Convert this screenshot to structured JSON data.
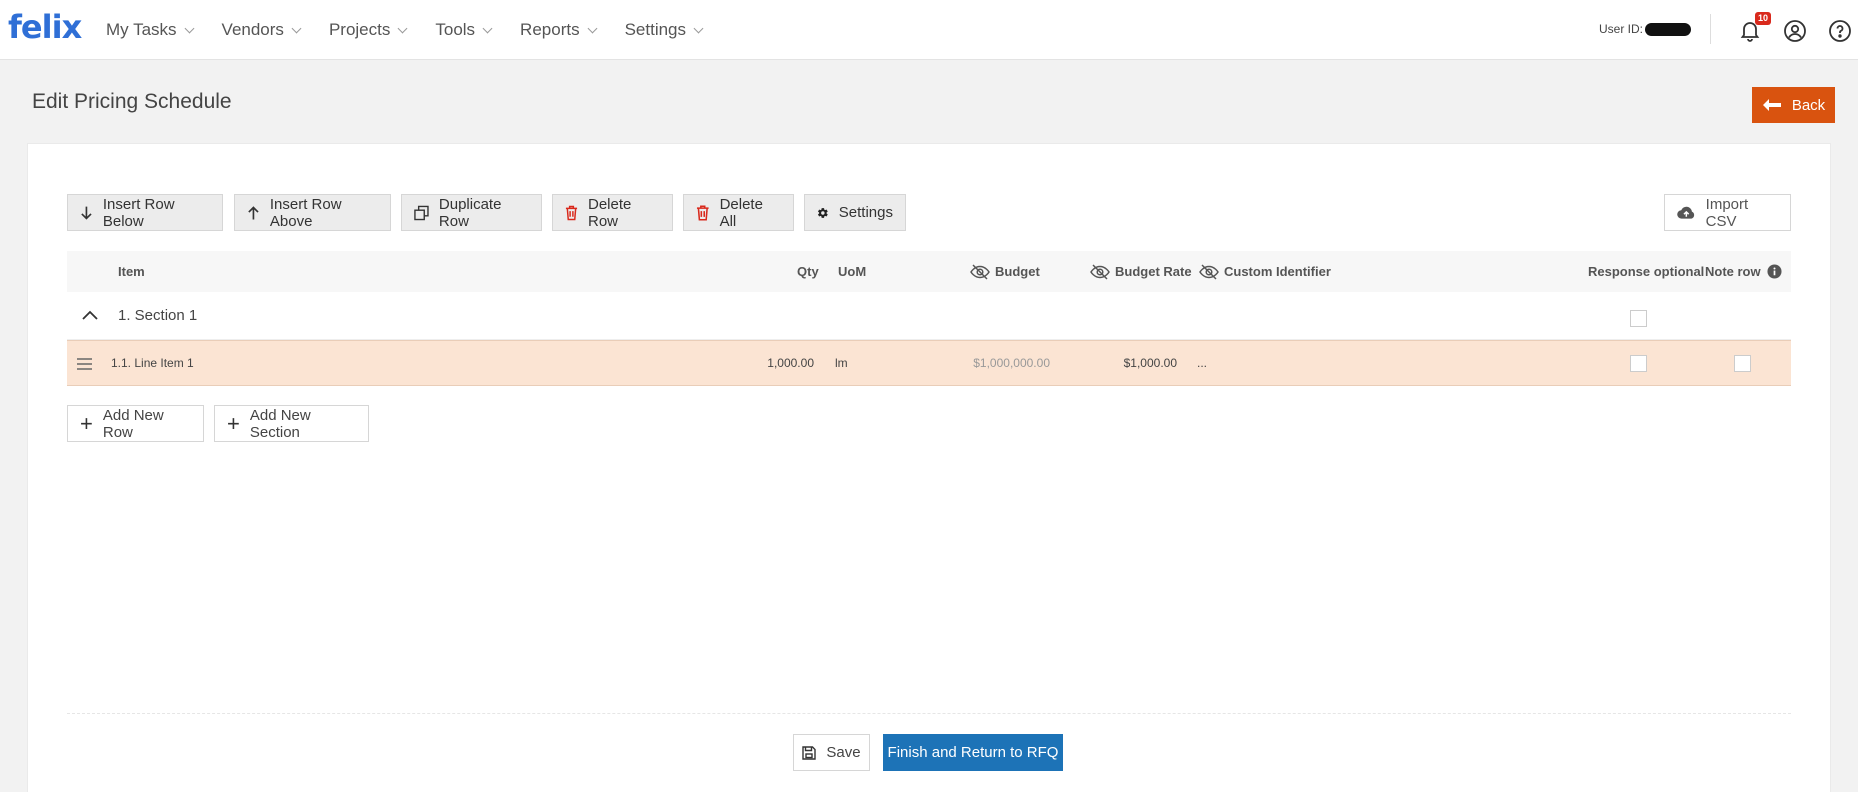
{
  "app": {
    "logo": "felix"
  },
  "nav": {
    "items": [
      {
        "label": "My Tasks"
      },
      {
        "label": "Vendors"
      },
      {
        "label": "Projects"
      },
      {
        "label": "Tools"
      },
      {
        "label": "Reports"
      },
      {
        "label": "Settings"
      }
    ],
    "user_id_label": "User ID:",
    "notifications_count": "10"
  },
  "page": {
    "title": "Edit Pricing Schedule",
    "back_label": "Back"
  },
  "toolbar": {
    "insert_below": "Insert Row Below",
    "insert_above": "Insert Row Above",
    "duplicate": "Duplicate Row",
    "delete_row": "Delete Row",
    "delete_all": "Delete All",
    "settings": "Settings",
    "import_csv": "Import CSV"
  },
  "table": {
    "headers": {
      "item": "Item",
      "qty": "Qty",
      "uom": "UoM",
      "budget": "Budget",
      "budget_rate": "Budget Rate",
      "custom_identifier": "Custom Identifier",
      "response_optional": "Response optional",
      "note_row": "Note row"
    },
    "section": {
      "label": "1. Section 1",
      "response_optional": false
    },
    "rows": [
      {
        "item": "1.1. Line Item 1",
        "qty": "1,000.00",
        "uom": "lm",
        "budget": "$1,000,000.00",
        "budget_rate": "$1,000.00",
        "custom_identifier": "...",
        "response_optional": false,
        "note_row": false
      }
    ]
  },
  "actions": {
    "add_row": "Add New Row",
    "add_section": "Add New Section",
    "save": "Save",
    "finish": "Finish and Return to RFQ"
  },
  "colors": {
    "brand": "#2f6fd6",
    "back_button": "#d9530f",
    "finish_button": "#1d73b7",
    "selected_row": "#fbe4d3",
    "delete_icon": "#d9291c"
  }
}
